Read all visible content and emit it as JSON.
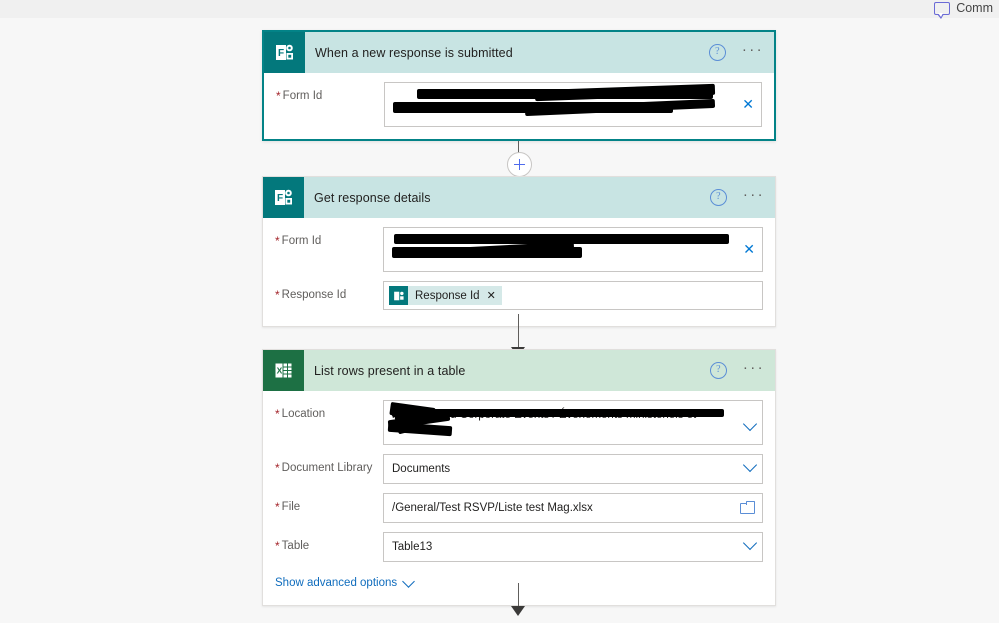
{
  "topbar": {
    "comments_label": "Comm",
    "comments_icon": "comment-bubble-icon"
  },
  "flow": {
    "cards": [
      {
        "title": "When a new response is submitted",
        "connector_icon": "microsoft-forms-icon",
        "help_icon": "help-circle-icon",
        "menu_icon": "ellipsis-icon",
        "selected": true,
        "fields": [
          {
            "label": "Form Id",
            "required": true,
            "value": "",
            "redacted": true,
            "control": "text-with-clear",
            "trailing_icon": "clear-x-icon"
          }
        ]
      },
      {
        "title": "Get response details",
        "connector_icon": "microsoft-forms-icon",
        "help_icon": "help-circle-icon",
        "menu_icon": "ellipsis-icon",
        "selected": false,
        "fields": [
          {
            "label": "Form Id",
            "required": true,
            "value": "",
            "redacted": true,
            "control": "text-with-clear",
            "trailing_icon": "clear-x-icon"
          },
          {
            "label": "Response Id",
            "required": true,
            "value": "",
            "control": "token",
            "token_label": "Response Id",
            "token_icon": "microsoft-forms-icon",
            "token_remove_icon": "remove-x-icon"
          }
        ]
      },
      {
        "title": "List rows present in a table",
        "connector_icon": "microsoft-excel-icon",
        "help_icon": "help-circle-icon",
        "menu_icon": "ellipsis-icon",
        "selected": false,
        "fields": [
          {
            "label": "Location",
            "required": true,
            "value": "inisterial and Corporate Events / Événements ministériels et",
            "redacted": true,
            "control": "dropdown",
            "trailing_icon": "chevron-down-icon"
          },
          {
            "label": "Document Library",
            "required": true,
            "value": "Documents",
            "control": "dropdown",
            "trailing_icon": "chevron-down-icon"
          },
          {
            "label": "File",
            "required": true,
            "value": "/General/Test RSVP/Liste test Mag.xlsx",
            "control": "file-picker",
            "trailing_icon": "folder-icon"
          },
          {
            "label": "Table",
            "required": true,
            "value": "Table13",
            "control": "dropdown",
            "trailing_icon": "chevron-down-icon"
          }
        ],
        "advanced_options_label": "Show advanced options",
        "advanced_options_icon": "chevron-down-icon"
      }
    ],
    "connectors": [
      {
        "has_add_button": true,
        "add_icon": "plus-icon"
      },
      {
        "has_add_button": false,
        "add_icon": ""
      },
      {
        "has_add_button": false,
        "add_icon": ""
      }
    ]
  },
  "colors": {
    "forms_teal": "#03787c",
    "forms_header": "#c8e4e3",
    "excel_green": "#1d7044",
    "excel_header": "#cfe7d8",
    "selected_border": "#038387",
    "link_blue": "#0f6cbd",
    "required_red": "#a4262c",
    "canvas": "#f7f7f7"
  }
}
